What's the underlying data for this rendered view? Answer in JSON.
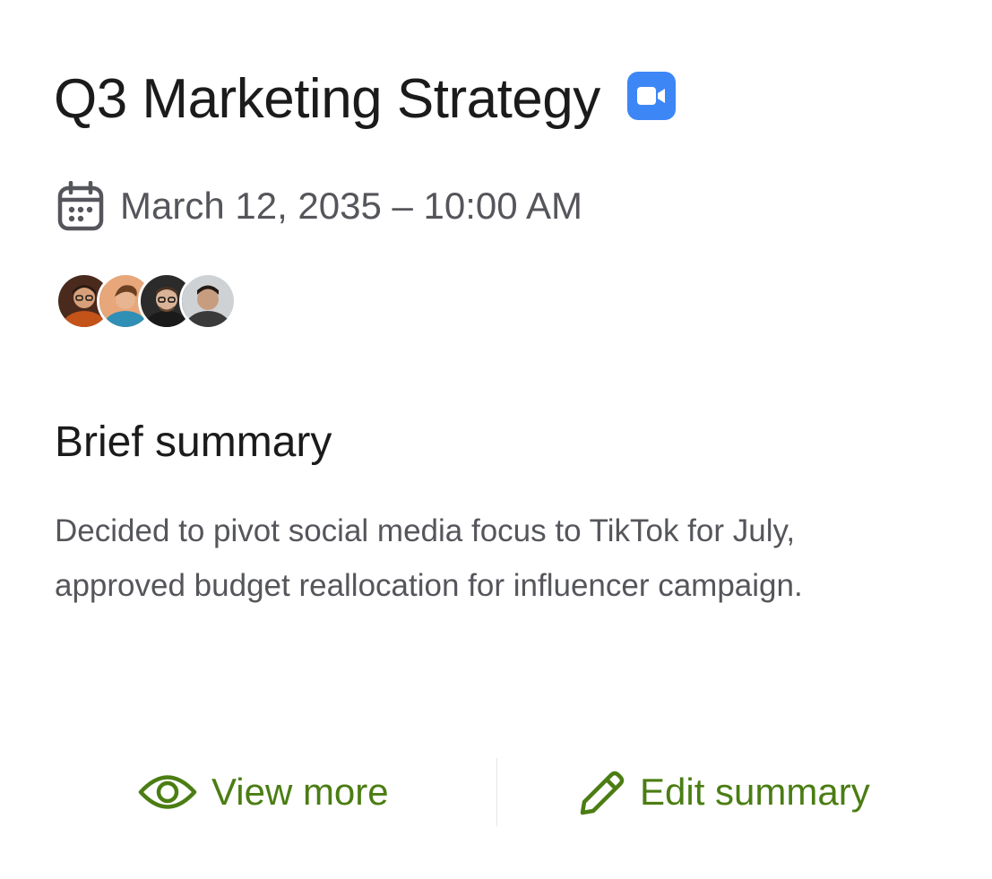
{
  "meeting": {
    "title": "Q3 Marketing Strategy",
    "platform_icon": "video-camera-icon",
    "datetime": "March 12, 2035 – 10:00 AM",
    "attendees": [
      {
        "icon": "avatar-1"
      },
      {
        "icon": "avatar-2"
      },
      {
        "icon": "avatar-3"
      },
      {
        "icon": "avatar-4"
      }
    ]
  },
  "summary": {
    "heading": "Brief summary",
    "text": "Decided to pivot social media focus to TikTok for July, approved budget reallocation for influencer campaign."
  },
  "actions": {
    "view_more_label": "View more",
    "edit_summary_label": "Edit summary"
  },
  "colors": {
    "accent_green": "#4b7d13",
    "video_blue": "#3d86f6",
    "text_dark": "#1b1b1b",
    "text_muted": "#55565b"
  }
}
